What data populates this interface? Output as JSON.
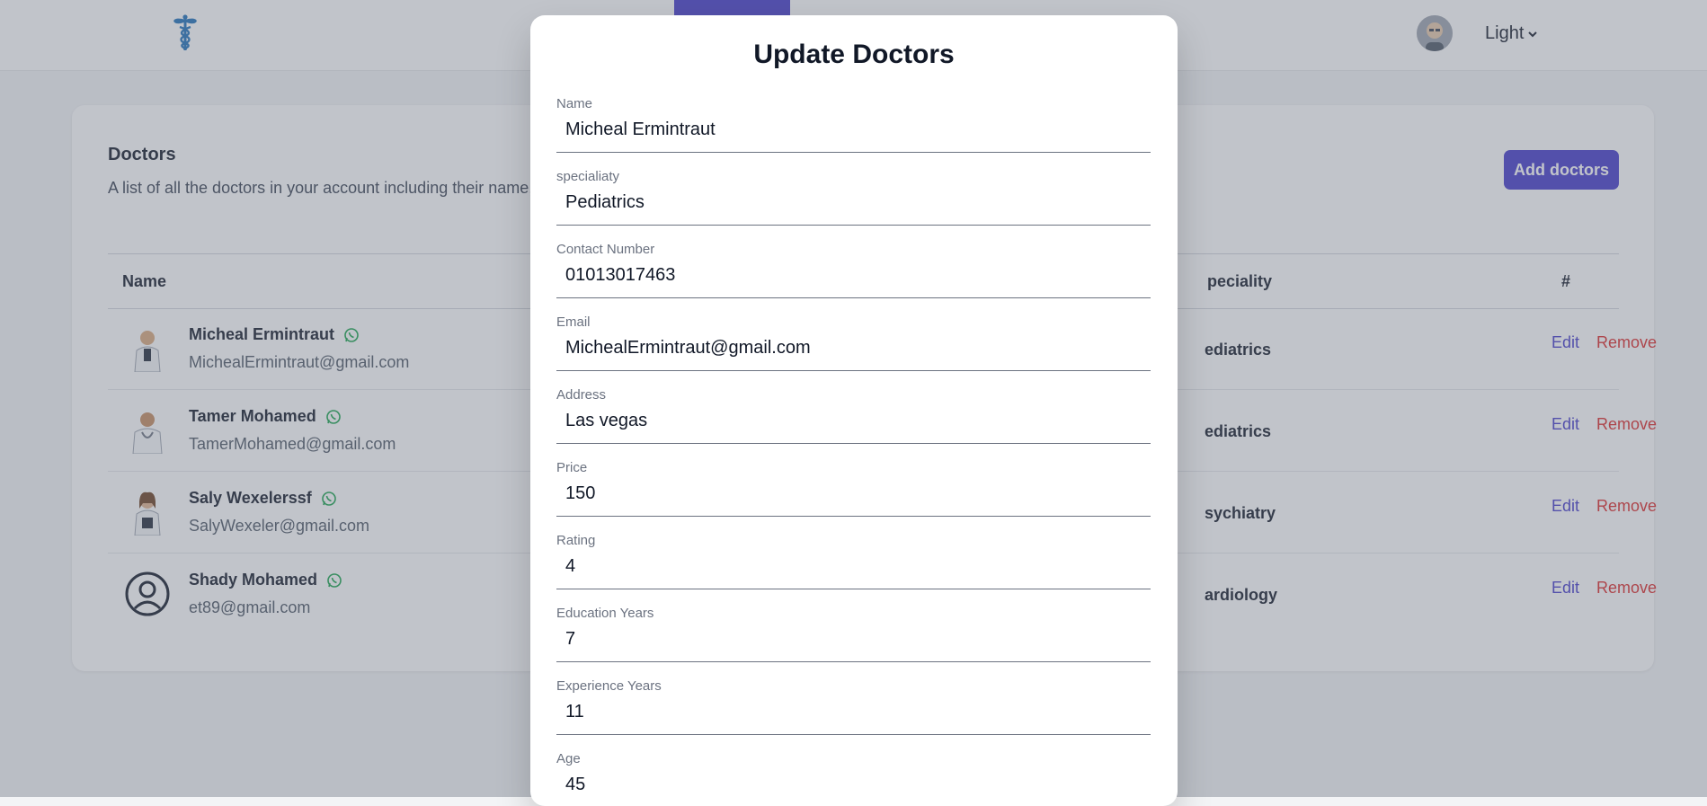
{
  "header": {
    "logo_icon": "caduceus-icon",
    "avatar_icon": "user-avatar",
    "theme_label": "Light"
  },
  "doctors_card": {
    "title": "Doctors",
    "description": "A list of all the doctors in your account including their name,",
    "add_button": "Add doctors",
    "columns": {
      "name": "Name",
      "speciality": "peciality",
      "actions": "#"
    },
    "rows": [
      {
        "name": "Micheal Ermintraut",
        "email": "MichealErmintraut@gmail.com",
        "speciality": "ediatrics",
        "edit": "Edit",
        "remove": "Remove"
      },
      {
        "name": "Tamer Mohamed",
        "email": "TamerMohamed@gmail.com",
        "speciality": "ediatrics",
        "edit": "Edit",
        "remove": "Remove"
      },
      {
        "name": "Saly Wexelerssf",
        "email": "SalyWexeler@gmail.com",
        "speciality": "sychiatry",
        "edit": "Edit",
        "remove": "Remove"
      },
      {
        "name": "Shady Mohamed",
        "email": "et89@gmail.com",
        "speciality": "ardiology",
        "edit": "Edit",
        "remove": "Remove"
      }
    ]
  },
  "modal": {
    "title": "Update Doctors",
    "fields": [
      {
        "label": "Name",
        "value": "Micheal Ermintraut"
      },
      {
        "label": "specialiaty",
        "value": "Pediatrics"
      },
      {
        "label": "Contact Number",
        "value": "01013017463"
      },
      {
        "label": "Email",
        "value": "MichealErmintraut@gmail.com"
      },
      {
        "label": "Address",
        "value": "Las vegas"
      },
      {
        "label": "Price",
        "value": "150"
      },
      {
        "label": "Rating",
        "value": "4"
      },
      {
        "label": "Education Years",
        "value": "7"
      },
      {
        "label": "Experience Years",
        "value": "11"
      },
      {
        "label": "Age",
        "value": "45"
      }
    ]
  },
  "colors": {
    "primary": "#4338ca",
    "danger": "#dc2626",
    "whatsapp": "#16a34a"
  }
}
